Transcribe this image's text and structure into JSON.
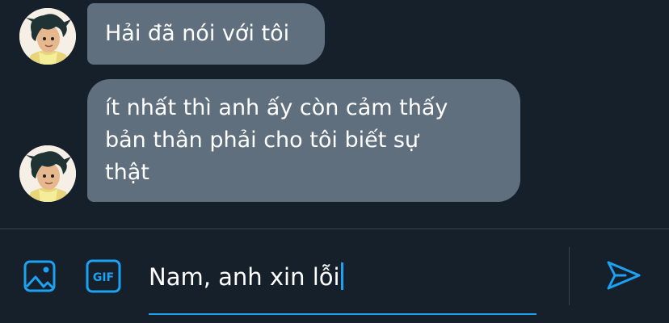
{
  "conversation": {
    "messages": [
      {
        "text": "Hải đã nói với tôi"
      },
      {
        "text_lines": [
          "ít nhất thì anh ấy còn cảm thấy",
          "bản thân phải cho tôi biết sự",
          "thật"
        ]
      }
    ]
  },
  "composer": {
    "input_value": "Nam, anh xin lỗi",
    "media_icon": "image-icon",
    "gif_icon": "gif-icon",
    "gif_text": "GIF",
    "send_icon": "send-icon"
  },
  "colors": {
    "background": "#15202b",
    "bubble": "#5f6f7e",
    "accent": "#1da1f2",
    "divider": "#38444d"
  }
}
